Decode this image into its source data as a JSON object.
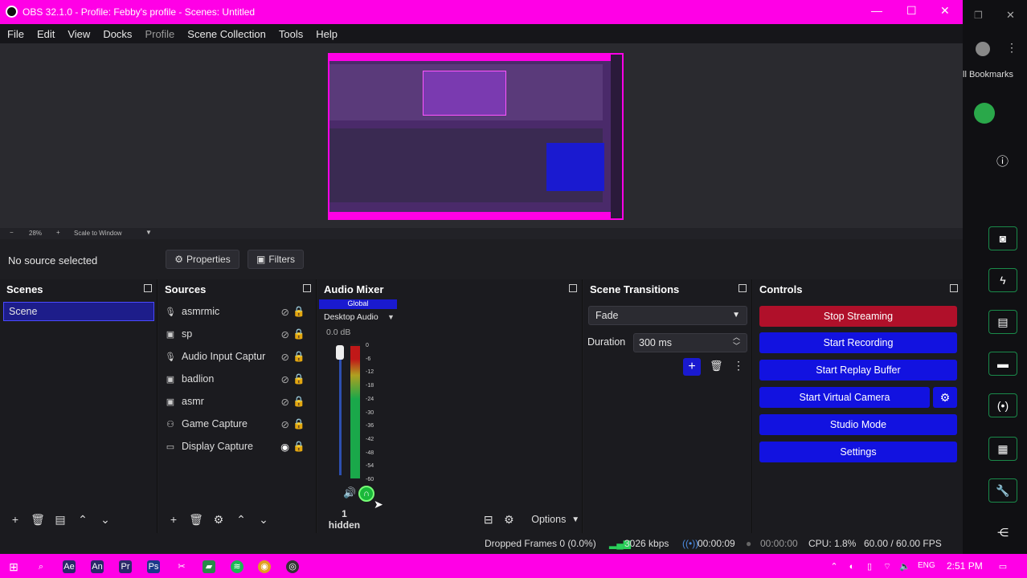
{
  "title": "OBS 32.1.0 - Profile: Febby's profile - Scenes: Untitled",
  "menu": [
    "File",
    "Edit",
    "View",
    "Docks",
    "Profile",
    "Scene Collection",
    "Tools",
    "Help"
  ],
  "zoom": {
    "minus": "−",
    "percent": "28%",
    "plus": "+",
    "scale": "Scale to Window"
  },
  "source_bar": {
    "no_source": "No source selected",
    "properties": "Properties",
    "filters": "Filters"
  },
  "scenes": {
    "title": "Scenes",
    "items": [
      "Scene"
    ]
  },
  "sources": {
    "title": "Sources",
    "items": [
      "asmrmic",
      "sp",
      "Audio Input Captur",
      "badlion",
      "asmr",
      "Game Capture",
      "Display Capture"
    ]
  },
  "audio": {
    "title": "Audio Mixer",
    "global": "Global",
    "device": "Desktop Audio",
    "level": "0.0 dB",
    "ticks": [
      "0",
      "-6",
      "-12",
      "-18",
      "-24",
      "-30",
      "-36",
      "-42",
      "-48",
      "-54",
      "-60"
    ],
    "hidden": "1 hidden",
    "options": "Options",
    "meter_fill": 0.98
  },
  "transitions": {
    "title": "Scene Transitions",
    "type": "Fade",
    "duration_label": "Duration",
    "duration": "300 ms"
  },
  "controls": {
    "title": "Controls",
    "buttons": [
      "Stop Streaming",
      "Start Recording",
      "Start Replay Buffer",
      "Start Virtual Camera",
      "Studio Mode",
      "Settings"
    ],
    "stop_color": "#b0102a",
    "btn_color": "#1212e0"
  },
  "status": {
    "dropped": "Dropped Frames 0 (0.0%)",
    "kbps": "3026 kbps",
    "stream_time": "00:00:09",
    "rec_time": "00:00:00",
    "cpu": "CPU: 1.8%",
    "fps": "60.00 / 60.00 FPS"
  },
  "taskbar": {
    "lang": "ENG",
    "time": "2:51 PM"
  },
  "browser": {
    "bookmarks": "ll Bookmarks"
  }
}
